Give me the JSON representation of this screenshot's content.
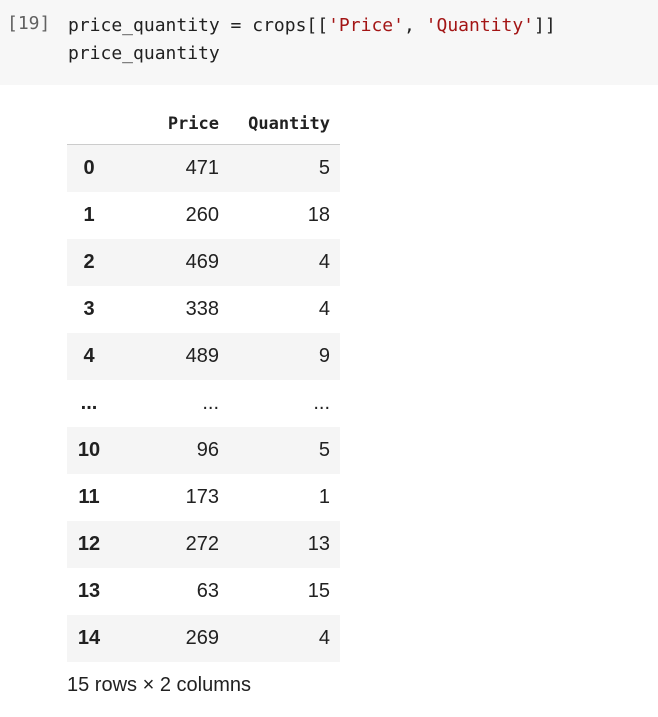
{
  "cell": {
    "execution_count": "[19]",
    "code_lines": [
      [
        {
          "text": "price_quantity = crops[[",
          "kind": "plain"
        },
        {
          "text": "'Price'",
          "kind": "str"
        },
        {
          "text": ", ",
          "kind": "plain"
        },
        {
          "text": "'Quantity'",
          "kind": "str"
        },
        {
          "text": "]]",
          "kind": "plain"
        }
      ],
      [
        {
          "text": "price_quantity",
          "kind": "plain"
        }
      ]
    ]
  },
  "output": {
    "columns": [
      "Price",
      "Quantity"
    ],
    "rows": [
      {
        "index": "0",
        "values": [
          "471",
          "5"
        ]
      },
      {
        "index": "1",
        "values": [
          "260",
          "18"
        ]
      },
      {
        "index": "2",
        "values": [
          "469",
          "4"
        ]
      },
      {
        "index": "3",
        "values": [
          "338",
          "4"
        ]
      },
      {
        "index": "4",
        "values": [
          "489",
          "9"
        ]
      },
      {
        "index": "...",
        "values": [
          "...",
          "..."
        ]
      },
      {
        "index": "10",
        "values": [
          "96",
          "5"
        ]
      },
      {
        "index": "11",
        "values": [
          "173",
          "1"
        ]
      },
      {
        "index": "12",
        "values": [
          "272",
          "13"
        ]
      },
      {
        "index": "13",
        "values": [
          "63",
          "15"
        ]
      },
      {
        "index": "14",
        "values": [
          "269",
          "4"
        ]
      }
    ],
    "shape_text": "15 rows × 2 columns"
  },
  "colors": {
    "code_background": "#f7f7f7",
    "string_literal": "#a31515",
    "striped_row": "#f5f5f5"
  }
}
